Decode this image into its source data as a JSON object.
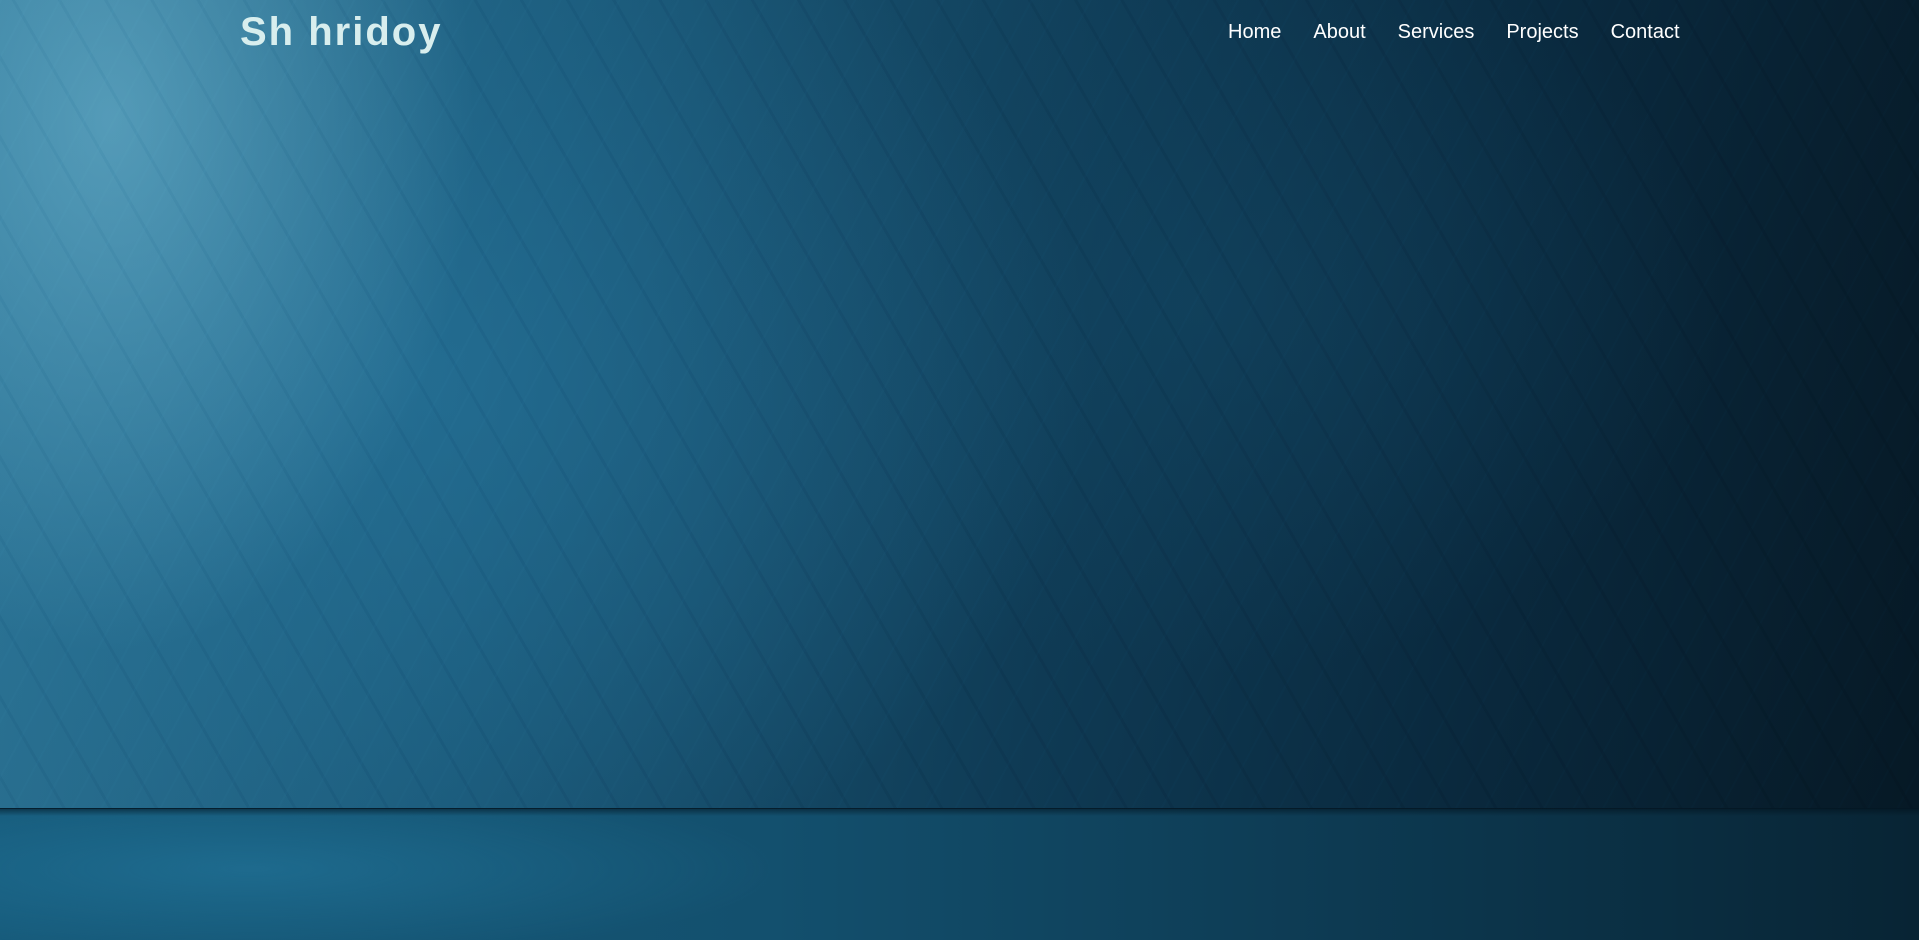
{
  "header": {
    "logo": "Sh hridoy",
    "nav": [
      {
        "label": "Home"
      },
      {
        "label": "About"
      },
      {
        "label": "Services"
      },
      {
        "label": "Projects"
      },
      {
        "label": "Contact"
      }
    ]
  },
  "colors": {
    "logo_text": "#d8eeee",
    "nav_text": "#ffffff",
    "background_light": "#2d7596",
    "background_dark": "#061824"
  }
}
